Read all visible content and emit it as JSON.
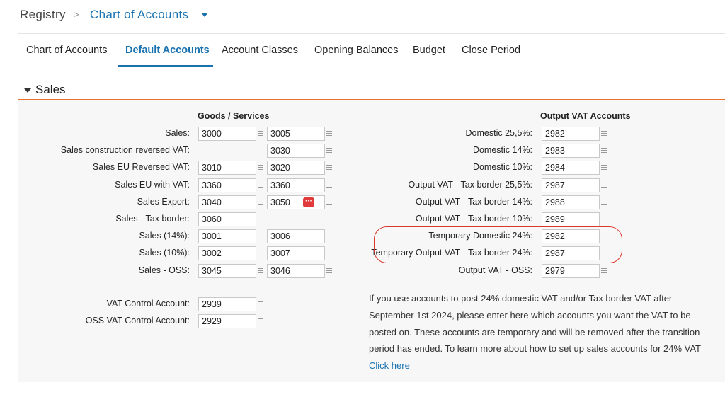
{
  "breadcrumb": {
    "root": "Registry",
    "separator": ">",
    "current": "Chart of Accounts"
  },
  "tabs": [
    {
      "label": "Chart of Accounts",
      "active": false
    },
    {
      "label": "Default Accounts",
      "active": true
    },
    {
      "label": "Account Classes",
      "active": false
    },
    {
      "label": "Opening Balances",
      "active": false
    },
    {
      "label": "Budget",
      "active": false
    },
    {
      "label": "Close Period",
      "active": false
    }
  ],
  "section": {
    "title": "Sales"
  },
  "goods": {
    "heading": "Goods / Services",
    "rows": [
      {
        "label": "Sales:",
        "goods": "3000",
        "services": "3005"
      },
      {
        "label": "Sales construction reversed VAT:",
        "goods": null,
        "services": "3030"
      },
      {
        "label": "Sales EU Reversed VAT:",
        "goods": "3010",
        "services": "3020"
      },
      {
        "label": "Sales EU with VAT:",
        "goods": "3360",
        "services": "3360"
      },
      {
        "label": "Sales Export:",
        "goods": "3040",
        "services": "3050"
      },
      {
        "label": "Sales - Tax border:",
        "goods": "3060",
        "services": null
      },
      {
        "label": "Sales (14%):",
        "goods": "3001",
        "services": "3006"
      },
      {
        "label": "Sales (10%):",
        "goods": "3002",
        "services": "3007"
      },
      {
        "label": "Sales - OSS:",
        "goods": "3045",
        "services": "3046"
      }
    ],
    "control": [
      {
        "label": "VAT Control Account:",
        "value": "2939"
      },
      {
        "label": "OSS VAT Control Account:",
        "value": "2929"
      }
    ],
    "more_button": "···"
  },
  "vat": {
    "heading": "Output VAT Accounts",
    "rows": [
      {
        "label": "Domestic 25,5%:",
        "value": "2982"
      },
      {
        "label": "Domestic 14%:",
        "value": "2983"
      },
      {
        "label": "Domestic 10%:",
        "value": "2984"
      },
      {
        "label": "Output VAT - Tax border 25,5%:",
        "value": "2987"
      },
      {
        "label": "Output VAT - Tax border 14%:",
        "value": "2988"
      },
      {
        "label": "Output VAT - Tax border 10%:",
        "value": "2989"
      },
      {
        "label": "Temporary Domestic 24%:",
        "value": "2982"
      },
      {
        "label": "Temporary Output VAT - Tax border 24%:",
        "value": "2987"
      },
      {
        "label": "Output VAT - OSS:",
        "value": "2979"
      }
    ],
    "info_text": "If you use accounts to post 24% domestic VAT and/or Tax border VAT after September 1st 2024, please enter here which accounts you want the VAT to be posted on. These accounts are temporary and will be removed after the transition period has ended. To learn more about how to set up sales accounts for 24% VAT",
    "info_link": "Click here"
  },
  "colors": {
    "accent": "#1a73b0",
    "section_rule": "#e8722c",
    "highlight": "#d9372b",
    "more_button": "#e03a3a"
  },
  "icons": {
    "list": "list-icon",
    "caret": "caret-down-icon",
    "more": "more-dots-icon"
  }
}
